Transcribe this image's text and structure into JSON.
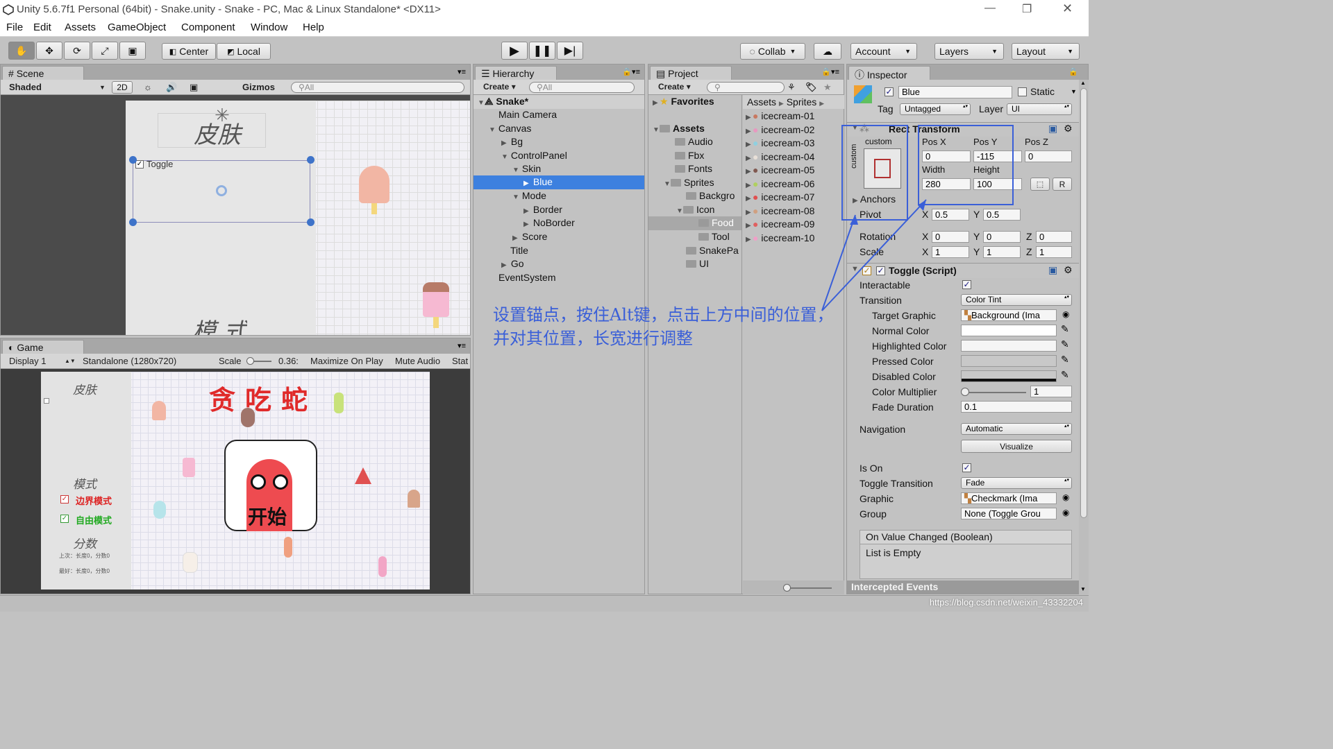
{
  "window": {
    "title": "Unity 5.6.7f1 Personal (64bit) - Snake.unity - Snake - PC, Mac & Linux Standalone* <DX11>"
  },
  "menu": [
    "File",
    "Edit",
    "Assets",
    "GameObject",
    "Component",
    "Window",
    "Help"
  ],
  "toolbar": {
    "center": "Center",
    "local": "Local",
    "collab": "Collab",
    "account": "Account",
    "layers": "Layers",
    "layout": "Layout"
  },
  "scene": {
    "tab": "Scene",
    "shaded": "Shaded",
    "mode2d": "2D",
    "gizmos": "Gizmos",
    "search": "All",
    "skin_title": "皮肤",
    "toggle_label": "Toggle",
    "mode_title": "模 式"
  },
  "game": {
    "tab": "Game",
    "display": "Display 1",
    "resolution": "Standalone (1280x720)",
    "scale_label": "Scale",
    "scale_value": "0.36:",
    "maximize": "Maximize On Play",
    "mute": "Mute Audio",
    "stats": "Stat",
    "skin": "皮肤",
    "mode": "模式",
    "border_mode": "边界模式",
    "free_mode": "自由模式",
    "score": "分数",
    "last": "上次：长度0，分数0",
    "best": "最好：长度0，分数0",
    "title": "贪吃蛇",
    "start": "开始"
  },
  "hierarchy": {
    "tab": "Hierarchy",
    "create": "Create",
    "search": "All",
    "root": "Snake*",
    "items": [
      "Main Camera",
      "Canvas",
      "Bg",
      "ControlPanel",
      "Skin",
      "Blue",
      "Mode",
      "Border",
      "NoBorder",
      "Score",
      "Title",
      "Go",
      "EventSystem"
    ]
  },
  "project": {
    "tab": "Project",
    "create": "Create",
    "favorites": "Favorites",
    "assets": "Assets",
    "folders": [
      "Audio",
      "Fbx",
      "Fonts",
      "Sprites",
      "Backgro",
      "Icon",
      "Food",
      "Tool",
      "SnakePa",
      "UI"
    ],
    "breadcrumb": [
      "Assets",
      "Sprites"
    ],
    "files": [
      "icecream-01",
      "icecream-02",
      "icecream-03",
      "icecream-04",
      "icecream-05",
      "icecream-06",
      "icecream-07",
      "icecream-08",
      "icecream-09",
      "icecream-10"
    ]
  },
  "inspector": {
    "tab": "Inspector",
    "name": "Blue",
    "static": "Static",
    "tag_label": "Tag",
    "tag": "Untagged",
    "layer_label": "Layer",
    "layer": "UI",
    "rect": {
      "title": "Rect Transform",
      "custom": "custom",
      "posx_l": "Pos X",
      "posy_l": "Pos Y",
      "posz_l": "Pos Z",
      "posx": "0",
      "posy": "-115",
      "posz": "0",
      "width_l": "Width",
      "height_l": "Height",
      "width": "280",
      "height": "100",
      "anchors": "Anchors",
      "pivot": "Pivot",
      "px": "0.5",
      "py": "0.5",
      "rotation": "Rotation",
      "scale": "Scale",
      "rx": "0",
      "ry": "0",
      "rz": "0",
      "sx": "1",
      "sy": "1",
      "sz": "1",
      "R": "R",
      "X": "X",
      "Y": "Y",
      "Z": "Z"
    },
    "toggle": {
      "title": "Toggle (Script)",
      "interactable": "Interactable",
      "transition": "Transition",
      "transition_v": "Color Tint",
      "target": "Target Graphic",
      "target_v": "Background (Ima",
      "normal": "Normal Color",
      "highlighted": "Highlighted Color",
      "pressed": "Pressed Color",
      "disabled": "Disabled Color",
      "multiplier": "Color Multiplier",
      "multiplier_v": "1",
      "fade": "Fade Duration",
      "fade_v": "0.1",
      "navigation": "Navigation",
      "navigation_v": "Automatic",
      "visualize": "Visualize",
      "ison": "Is On",
      "toggle_transition": "Toggle Transition",
      "toggle_transition_v": "Fade",
      "graphic": "Graphic",
      "graphic_v": "Checkmark (Ima",
      "group": "Group",
      "group_v": "None (Toggle Grou",
      "event": "On Value Changed (Boolean)",
      "list_empty": "List is Empty",
      "intercepted": "Intercepted Events"
    }
  },
  "annotation": {
    "line1": "设置锚点，按住Alt键，点击上方中间的位置，",
    "line2": "并对其位置，长宽进行调整"
  },
  "watermark": "https://blog.csdn.net/weixin_43332204",
  "colors": {
    "selection": "#3d80df",
    "annotation": "#3a5fd8",
    "snake": "#ee4b50",
    "title_red": "#e02a2a"
  }
}
